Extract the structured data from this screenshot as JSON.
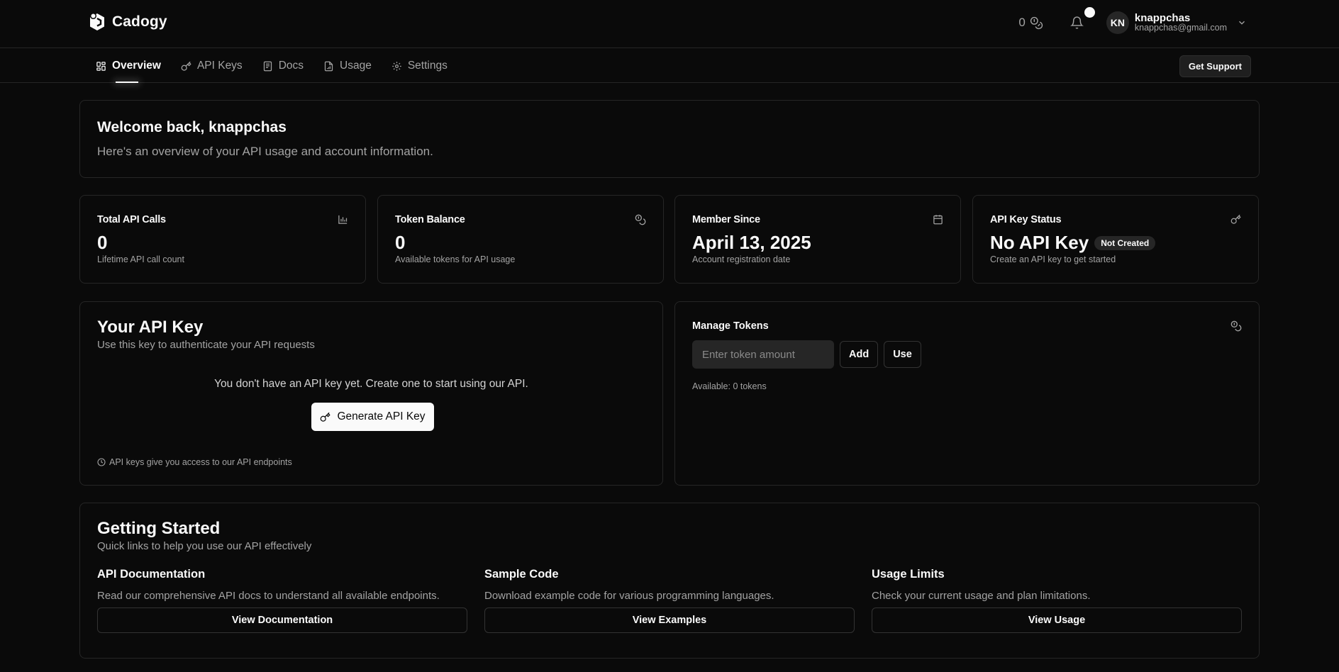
{
  "brand": {
    "name": "Cadogy",
    "logo_icon": "cadogy-logo-icon"
  },
  "header": {
    "token_count": "0",
    "token_icon": "coins-icon",
    "bell_icon": "bell-icon",
    "user": {
      "initials": "KN",
      "name": "knappchas",
      "email": "knappchas@gmail.com"
    }
  },
  "nav": {
    "tabs": [
      {
        "label": "Overview",
        "icon": "grid-icon",
        "active": true
      },
      {
        "label": "API Keys",
        "icon": "key-icon",
        "active": false
      },
      {
        "label": "Docs",
        "icon": "document-icon",
        "active": false
      },
      {
        "label": "Usage",
        "icon": "file-chart-icon",
        "active": false
      },
      {
        "label": "Settings",
        "icon": "gear-icon",
        "active": false
      }
    ],
    "support_label": "Get Support"
  },
  "welcome": {
    "title": "Welcome back, knappchas",
    "subtitle": "Here's an overview of your API usage and account information."
  },
  "stats": [
    {
      "title": "Total API Calls",
      "value": "0",
      "sub": "Lifetime API call count",
      "icon": "bar-chart-icon"
    },
    {
      "title": "Token Balance",
      "value": "0",
      "sub": "Available tokens for API usage",
      "icon": "coins-icon"
    },
    {
      "title": "Member Since",
      "value": "April 13, 2025",
      "sub": "Account registration date",
      "icon": "calendar-icon"
    },
    {
      "title": "API Key Status",
      "value": "No API Key",
      "badge": "Not Created",
      "sub": "Create an API key to get started",
      "icon": "key-icon"
    }
  ],
  "api_key": {
    "title": "Your API Key",
    "subtitle": "Use this key to authenticate your API requests",
    "empty_text": "You don't have an API key yet. Create one to start using our API.",
    "generate_label": "Generate API Key",
    "note": "API keys give you access to our API endpoints"
  },
  "tokens": {
    "title": "Manage Tokens",
    "placeholder": "Enter token amount",
    "add_label": "Add",
    "use_label": "Use",
    "available": "Available: 0 tokens"
  },
  "getting_started": {
    "title": "Getting Started",
    "subtitle": "Quick links to help you use our API effectively",
    "items": [
      {
        "title": "API Documentation",
        "desc": "Read our comprehensive API docs to understand all available endpoints.",
        "button": "View Documentation"
      },
      {
        "title": "Sample Code",
        "desc": "Download example code for various programming languages.",
        "button": "View Examples"
      },
      {
        "title": "Usage Limits",
        "desc": "Check your current usage and plan limitations.",
        "button": "View Usage"
      }
    ]
  }
}
